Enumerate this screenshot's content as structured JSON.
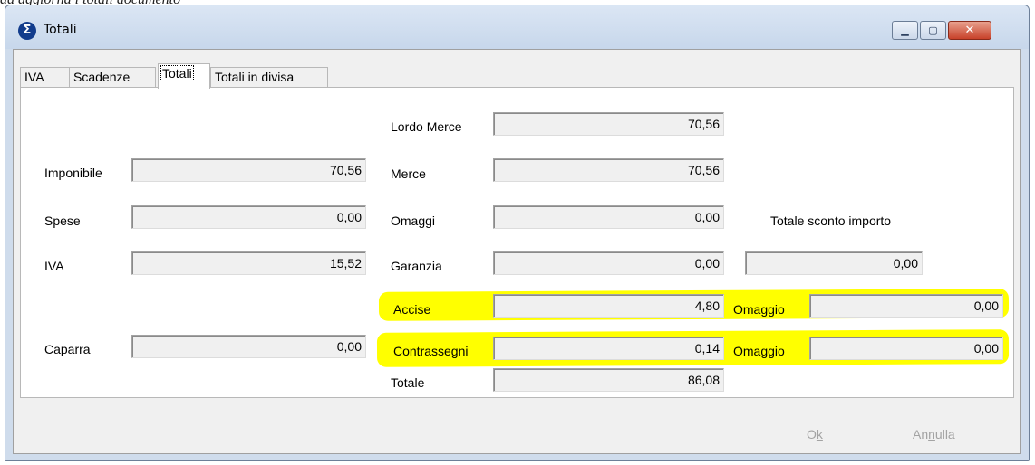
{
  "top_caption": "aa aggiorna i totali documento",
  "window": {
    "title": "Totali",
    "app_icon": "sigma-icon",
    "minimize_icon": "minimize-icon",
    "maximize_icon": "maximize-icon",
    "close_icon": "close-icon"
  },
  "tabs": [
    {
      "label": "IVA",
      "active": false
    },
    {
      "label": "Scadenze",
      "active": false
    },
    {
      "label": "Totali",
      "active": true
    },
    {
      "label": "Totali in divisa",
      "active": false
    }
  ],
  "left_column": {
    "imponibile": {
      "label": "Imponibile",
      "value": "70,56"
    },
    "spese": {
      "label": "Spese",
      "value": "0,00"
    },
    "iva": {
      "label": "IVA",
      "value": "15,52"
    },
    "caparra": {
      "label": "Caparra",
      "value": "0,00"
    }
  },
  "middle_column": {
    "lordo_merce": {
      "label": "Lordo Merce",
      "value": "70,56"
    },
    "merce": {
      "label": "Merce",
      "value": "70,56"
    },
    "omaggi": {
      "label": "Omaggi",
      "value": "0,00"
    },
    "garanzia": {
      "label": "Garanzia",
      "value": "0,00"
    },
    "accise": {
      "label": "Accise",
      "value": "4,80"
    },
    "contrassegni": {
      "label": "Contrassegni",
      "value": "0,14"
    },
    "totale": {
      "label": "Totale",
      "value": "86,08"
    }
  },
  "right_column": {
    "sconto": {
      "label": "Totale sconto importo",
      "value": "0,00"
    },
    "omaggio_accise": {
      "label": "Omaggio",
      "value": "0,00"
    },
    "omaggio_contrassegni": {
      "label": "Omaggio",
      "value": "0,00"
    }
  },
  "buttons": {
    "ok": {
      "pre": "O",
      "underlined": "k",
      "post": ""
    },
    "annulla": {
      "pre": "An",
      "underlined": "n",
      "post": "ulla"
    }
  },
  "highlight_color": "#ffff00"
}
